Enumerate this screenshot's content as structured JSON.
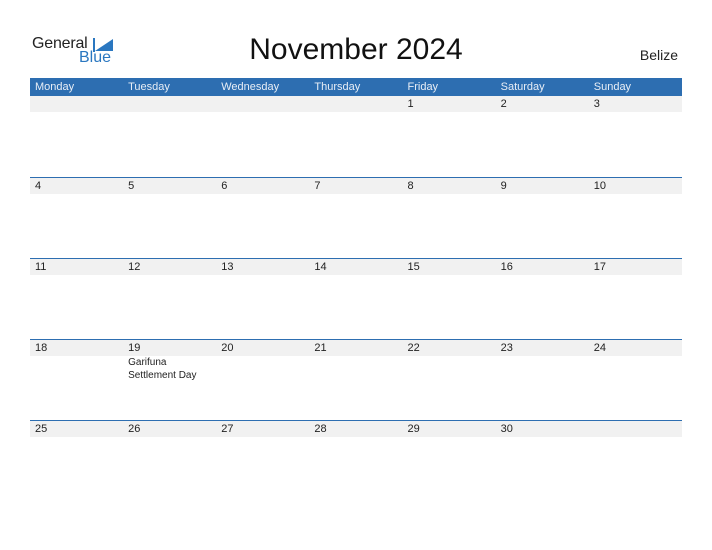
{
  "logo": {
    "word1": "General",
    "word2": "Blue"
  },
  "header": {
    "title": "November 2024",
    "country": "Belize"
  },
  "colors": {
    "accent": "#2d6eb1",
    "logo_blue": "#2a77c0",
    "date_strip": "#f1f1f1"
  },
  "weekdays": [
    "Monday",
    "Tuesday",
    "Wednesday",
    "Thursday",
    "Friday",
    "Saturday",
    "Sunday"
  ],
  "weeks": [
    {
      "days": [
        "",
        "",
        "",
        "",
        "1",
        "2",
        "3"
      ],
      "events": [
        "",
        "",
        "",
        "",
        "",
        "",
        ""
      ]
    },
    {
      "days": [
        "4",
        "5",
        "6",
        "7",
        "8",
        "9",
        "10"
      ],
      "events": [
        "",
        "",
        "",
        "",
        "",
        "",
        ""
      ]
    },
    {
      "days": [
        "11",
        "12",
        "13",
        "14",
        "15",
        "16",
        "17"
      ],
      "events": [
        "",
        "",
        "",
        "",
        "",
        "",
        ""
      ]
    },
    {
      "days": [
        "18",
        "19",
        "20",
        "21",
        "22",
        "23",
        "24"
      ],
      "events": [
        "",
        "Garifuna Settlement Day",
        "",
        "",
        "",
        "",
        ""
      ]
    },
    {
      "days": [
        "25",
        "26",
        "27",
        "28",
        "29",
        "30",
        ""
      ],
      "events": [
        "",
        "",
        "",
        "",
        "",
        "",
        ""
      ]
    }
  ]
}
